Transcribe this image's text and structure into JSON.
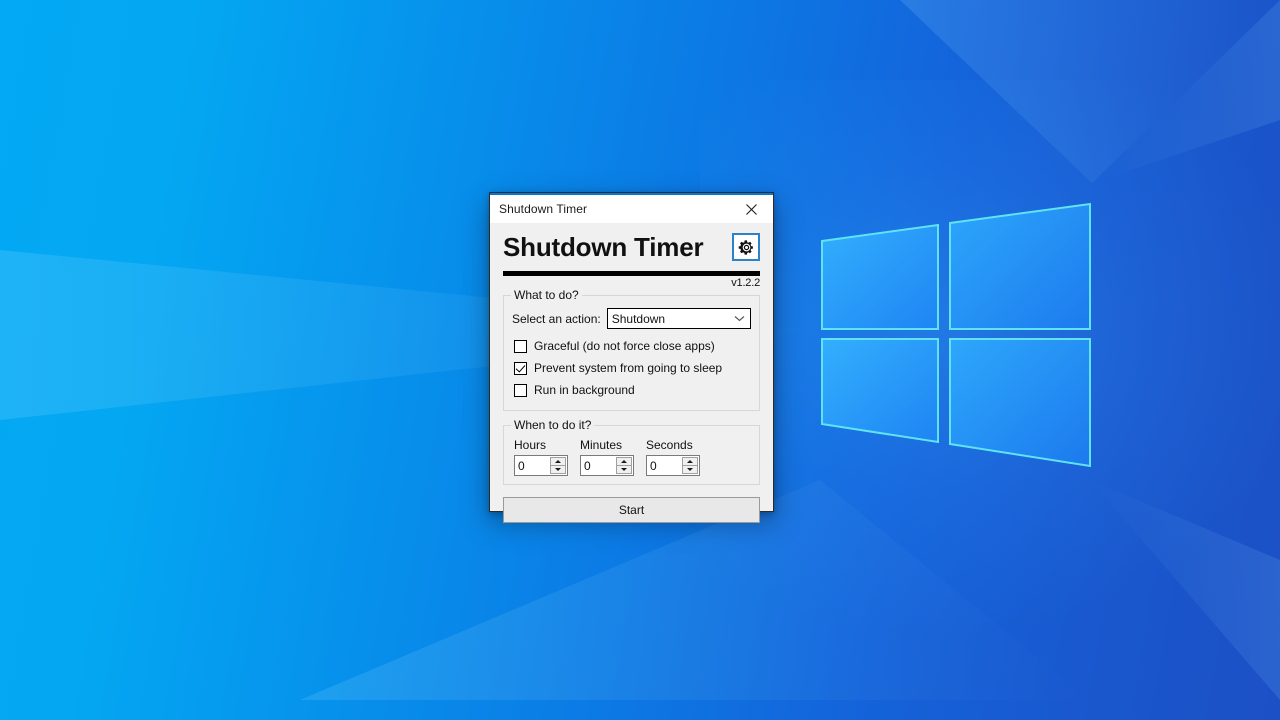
{
  "desktop": {
    "wallpaper_name": "windows-10-hero-wallpaper",
    "gradient_start": "#03A9F4",
    "gradient_end": "#1C50C6",
    "logo_edge_color": "#3FE0F0"
  },
  "window": {
    "titlebar": {
      "title": "Shutdown Timer",
      "accent_color": "#0078d7",
      "close_icon": "close-icon"
    },
    "header": {
      "app_title": "Shutdown Timer",
      "version": "v1.2.2",
      "settings_icon": "gear-icon",
      "settings_border_color": "#2c82c9"
    },
    "what_to_do": {
      "legend": "What to do?",
      "action_label": "Select an action:",
      "action_value": "Shutdown",
      "action_options": [
        "Shutdown"
      ],
      "dropdown_icon": "chevron-down-icon",
      "checkboxes": [
        {
          "label": "Graceful (do not force close apps)",
          "checked": false
        },
        {
          "label": "Prevent system from going to sleep",
          "checked": true
        },
        {
          "label": "Run in background",
          "checked": false
        }
      ]
    },
    "when_to_do_it": {
      "legend": "When to do it?",
      "fields": [
        {
          "caption": "Hours",
          "value": "0"
        },
        {
          "caption": "Minutes",
          "value": "0"
        },
        {
          "caption": "Seconds",
          "value": "0"
        }
      ],
      "spin_up_icon": "triangle-up-icon",
      "spin_down_icon": "triangle-down-icon"
    },
    "start_button_label": "Start"
  }
}
